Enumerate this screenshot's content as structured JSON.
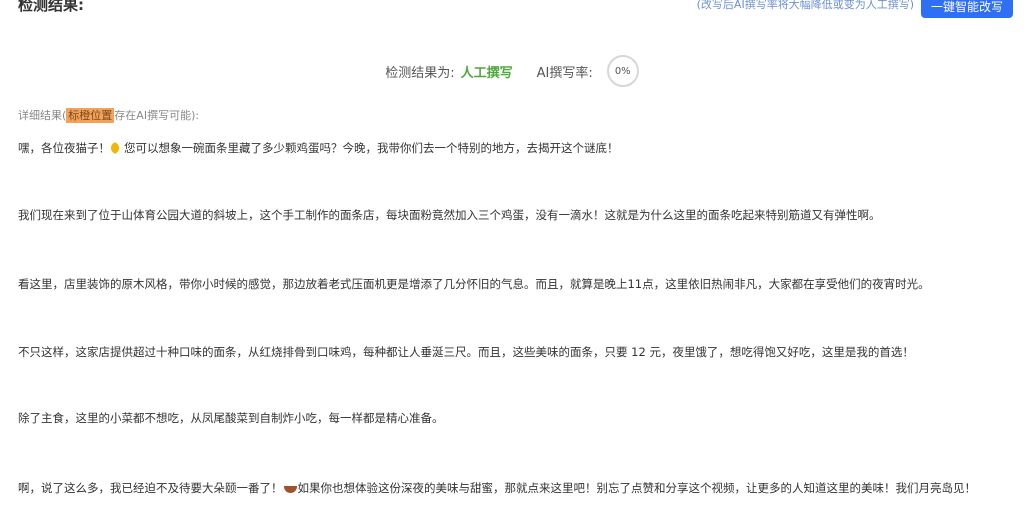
{
  "header": {
    "title": "检测结果:",
    "hint": "(改写后AI撰写率将大幅降低或变为人工撰写)",
    "rewrite_button": "一键智能改写"
  },
  "summary": {
    "result_label": "检测结果为:",
    "result_value": "人工撰写",
    "rate_label": "AI撰写率:",
    "rate_value": "0%",
    "rate_percent": 0
  },
  "detail": {
    "prefix": "详细结果(",
    "tag": "标橙位置",
    "suffix": "存在AI撰写可能):"
  },
  "paragraphs": [
    {
      "before_icon": "嘿，各位夜猫子！",
      "icon": "crescent-moon-icon",
      "after_icon": "您可以想象一碗面条里藏了多少颗鸡蛋吗？今晚，我带你们去一个特别的地方，去揭开这个谜底！"
    },
    {
      "text": "我们现在来到了位于山体育公园大道的斜坡上，这个手工制作的面条店，每块面粉竟然加入三个鸡蛋，没有一滴水！这就是为什么这里的面条吃起来特别筋道又有弹性啊。"
    },
    {
      "text": "看这里，店里装饰的原木风格，带你小时候的感觉，那边放着老式压面机更是增添了几分怀旧的气息。而且，就算是晚上11点，这里依旧热闹非凡，大家都在享受他们的夜宵时光。"
    },
    {
      "text": "不只这样，这家店提供超过十种口味的面条，从红烧排骨到口味鸡，每种都让人垂涎三尺。而且，这些美味的面条，只要 12 元，夜里饿了，想吃得饱又好吃，这里是我的首选！"
    },
    {
      "text": "除了主食，这里的小菜都不想吃，从凤尾酸菜到自制炸小吃，每一样都是精心准备。"
    },
    {
      "before_icon": "啊，说了这么多，我已经迫不及待要大朵颐一番了！",
      "icon": "noodle-bowl-icon",
      "after_icon": "如果你也想体验这份深夜的美味与甜蜜，那就点来这里吧！别忘了点赞和分享这个视频，让更多的人知道这里的美味！我们月亮岛见！"
    }
  ],
  "colors": {
    "accent": "#2f6ff5",
    "result_green": "#4fa83d",
    "highlight_orange": "#f4a15a",
    "hint_blue": "#6b8fd6"
  }
}
